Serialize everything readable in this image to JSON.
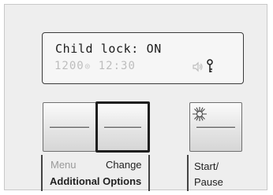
{
  "display": {
    "status_text": "Child lock: ON",
    "temperature": "1200",
    "temperature_unit_icon": "degree-icon",
    "time": "12:30",
    "sound_icon": "speaker-icon",
    "key_icon": "key-icon"
  },
  "buttons": {
    "menu_label": "Menu",
    "change_label": "Change",
    "group_label": "Additional Options",
    "start_pause_label_line1": "Start/",
    "start_pause_label_line2": "Pause",
    "start_indicator_icon": "blink-star-icon"
  },
  "colors": {
    "panel_bg": "#eeeeee",
    "inactive_text": "#9a9a9a",
    "active_text": "#222222",
    "selected_border": "#1e1e1e"
  }
}
